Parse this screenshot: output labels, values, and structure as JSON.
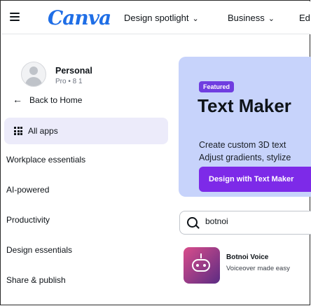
{
  "header": {
    "logo_text": "Canva",
    "nav": [
      {
        "label": "Design spotlight",
        "chevron": "⌄"
      },
      {
        "label": "Business",
        "chevron": "⌄"
      },
      {
        "label": "Ed"
      }
    ]
  },
  "sidebar": {
    "account": {
      "name": "Personal",
      "plan": "Pro • 8 1"
    },
    "back_label": "Back to Home",
    "all_apps_label": "All apps",
    "links": [
      "Workplace essentials",
      "AI-powered",
      "Productivity",
      "Design essentials",
      "Share & publish"
    ]
  },
  "hero": {
    "badge": "Featured",
    "title": "Text Maker",
    "desc_line1": "Create custom 3D text",
    "desc_line2": "Adjust gradients, stylize",
    "button": "Design with Text Maker"
  },
  "search": {
    "value": "botnoi"
  },
  "results": [
    {
      "name": "Botnoi Voice",
      "description": "Voiceover made easy",
      "icon": "robot-icon"
    }
  ],
  "colors": {
    "accent": "#7d2ae8",
    "hero_bg": "#c7d3fb",
    "logo": "#1f6ee6",
    "active_item_bg": "#ecebfa"
  }
}
